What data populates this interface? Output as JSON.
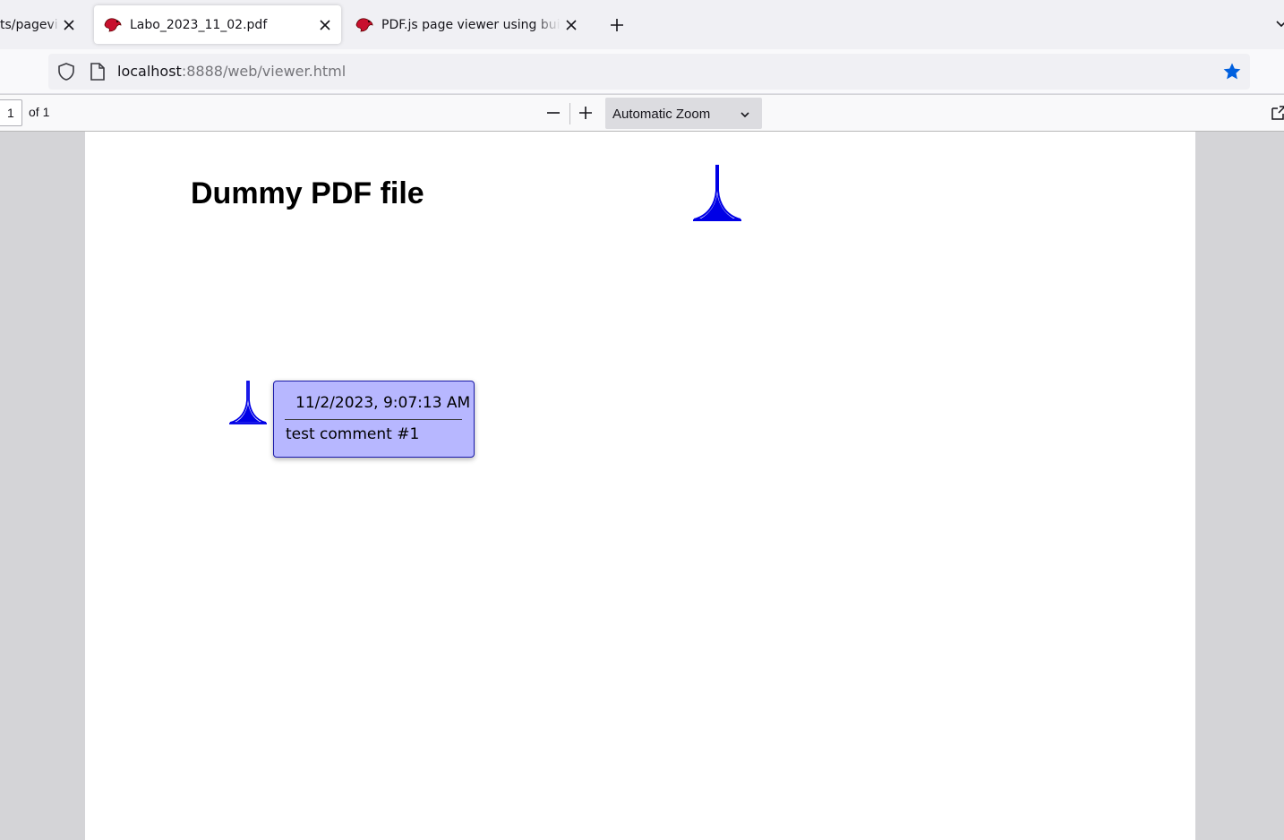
{
  "browser": {
    "tabs": [
      {
        "title": "ts/pageviewer",
        "favicon": "none",
        "active": false
      },
      {
        "title": "Labo_2023_11_02.pdf",
        "favicon": "pdf-fox-icon",
        "active": true
      },
      {
        "title": "PDF.js page viewer using built conten",
        "favicon": "pdf-fox-icon",
        "active": false
      }
    ],
    "url": {
      "host": "localhost",
      "rest": ":8888/web/viewer.html"
    },
    "bookmarked": true,
    "accent_color": "#0060df"
  },
  "pdf_toolbar": {
    "page_number": "1",
    "page_of": "of 1",
    "zoom_label": "Automatic Zoom"
  },
  "document": {
    "title": "Dummy PDF file",
    "annotation_color": "#0000e6",
    "popup": {
      "date": "11/2/2023, 9:07:13 AM",
      "comment": "test comment #1",
      "background": "#b7b7ff"
    }
  }
}
